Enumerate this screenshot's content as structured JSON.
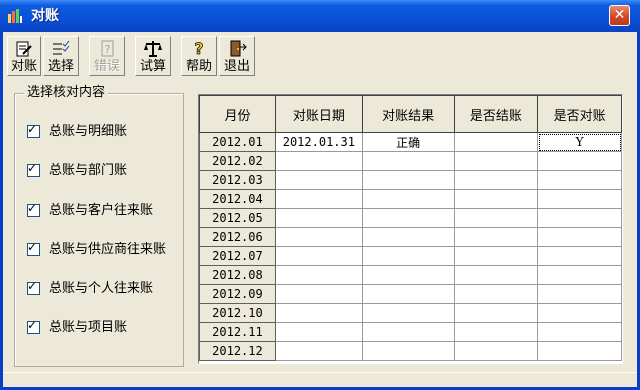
{
  "window": {
    "title": "对账",
    "close_glyph": "✕"
  },
  "toolbar": {
    "buttons": [
      {
        "label": "对账",
        "icon": "reconcile-icon",
        "enabled": true
      },
      {
        "label": "选择",
        "icon": "checklist-icon",
        "enabled": true
      },
      {
        "label": "错误",
        "icon": "error-question-icon",
        "enabled": false
      },
      {
        "label": "试算",
        "icon": "balance-scale-icon",
        "enabled": true
      },
      {
        "label": "帮助",
        "icon": "help-icon",
        "enabled": true
      },
      {
        "label": "退出",
        "icon": "exit-door-icon",
        "enabled": true
      }
    ]
  },
  "options": {
    "title": "选择核对内容",
    "items": [
      {
        "label": "总账与明细账",
        "checked": true
      },
      {
        "label": "总账与部门账",
        "checked": true
      },
      {
        "label": "总账与客户往来账",
        "checked": true
      },
      {
        "label": "总账与供应商往来账",
        "checked": true
      },
      {
        "label": "总账与个人往来账",
        "checked": true
      },
      {
        "label": "总账与项目账",
        "checked": true
      }
    ]
  },
  "grid": {
    "columns": [
      "月份",
      "对账日期",
      "对账结果",
      "是否结账",
      "是否对账"
    ],
    "rows": [
      [
        "2012.01",
        "2012.01.31",
        "正确",
        "",
        "Y"
      ],
      [
        "2012.02",
        "",
        "",
        "",
        ""
      ],
      [
        "2012.03",
        "",
        "",
        "",
        ""
      ],
      [
        "2012.04",
        "",
        "",
        "",
        ""
      ],
      [
        "2012.05",
        "",
        "",
        "",
        ""
      ],
      [
        "2012.06",
        "",
        "",
        "",
        ""
      ],
      [
        "2012.07",
        "",
        "",
        "",
        ""
      ],
      [
        "2012.08",
        "",
        "",
        "",
        ""
      ],
      [
        "2012.09",
        "",
        "",
        "",
        ""
      ],
      [
        "2012.10",
        "",
        "",
        "",
        ""
      ],
      [
        "2012.11",
        "",
        "",
        "",
        ""
      ],
      [
        "2012.12",
        "",
        "",
        "",
        ""
      ]
    ]
  },
  "colors": {
    "titlebar": "#0b50d8",
    "window_bg": "#ece9d8",
    "close_button": "#d2472a"
  }
}
